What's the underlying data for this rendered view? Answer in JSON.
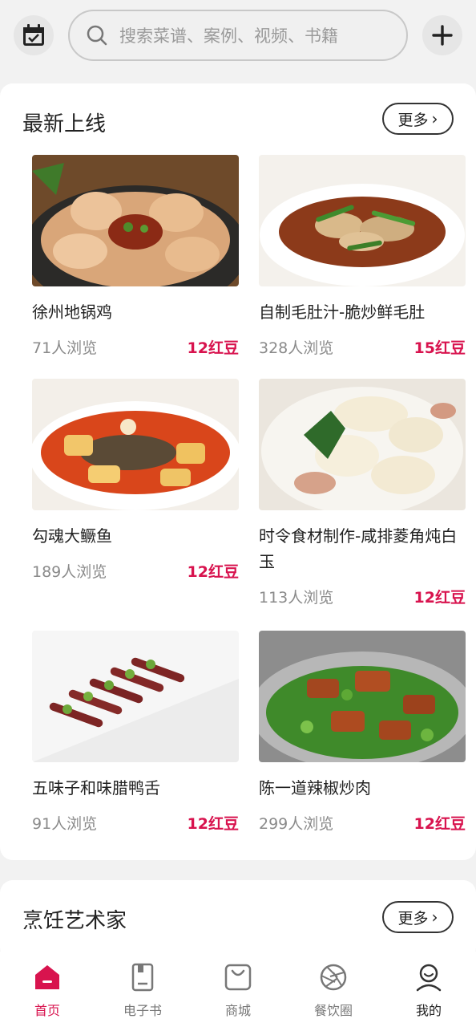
{
  "search": {
    "placeholder": "搜索菜谱、案例、视频、书籍"
  },
  "topbar": {
    "left_icon": "calendar-check-icon",
    "right_icon": "plus-icon"
  },
  "sections": {
    "newest": {
      "title": "最新上线",
      "more_label": "更多",
      "items": [
        {
          "name": "徐州地锅鸡",
          "views": "71人浏览",
          "price": "12红豆"
        },
        {
          "name": "自制毛肚汁-脆炒鲜毛肚",
          "views": "328人浏览",
          "price": "15红豆"
        },
        {
          "name": "勾魂大鳜鱼",
          "views": "189人浏览",
          "price": "12红豆"
        },
        {
          "name": "时令食材制作-咸排菱角炖白玉",
          "views": "113人浏览",
          "price": "12红豆"
        },
        {
          "name": "五味子和味腊鸭舌",
          "views": "91人浏览",
          "price": "12红豆"
        },
        {
          "name": "陈一道辣椒炒肉",
          "views": "299人浏览",
          "price": "12红豆"
        }
      ]
    },
    "artists": {
      "title": "烹饪艺术家",
      "more_label": "更多"
    }
  },
  "bottom_nav": [
    {
      "label": "首页",
      "icon": "home-icon",
      "active": true
    },
    {
      "label": "电子书",
      "icon": "ebook-icon",
      "active": false
    },
    {
      "label": "商城",
      "icon": "shopping-bag-icon",
      "active": false
    },
    {
      "label": "餐饮圈",
      "icon": "aperture-icon",
      "active": false
    },
    {
      "label": "我的",
      "icon": "profile-icon",
      "active": false
    }
  ],
  "colors": {
    "accent": "#d8134e",
    "background": "#f2f2f2",
    "card": "#ffffff"
  }
}
